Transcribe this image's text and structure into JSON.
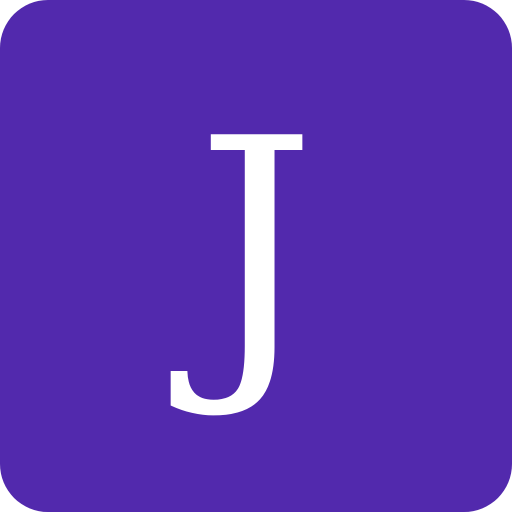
{
  "tile": {
    "letter": "J",
    "background_color": "#5229ad",
    "text_color": "#ffffff"
  }
}
